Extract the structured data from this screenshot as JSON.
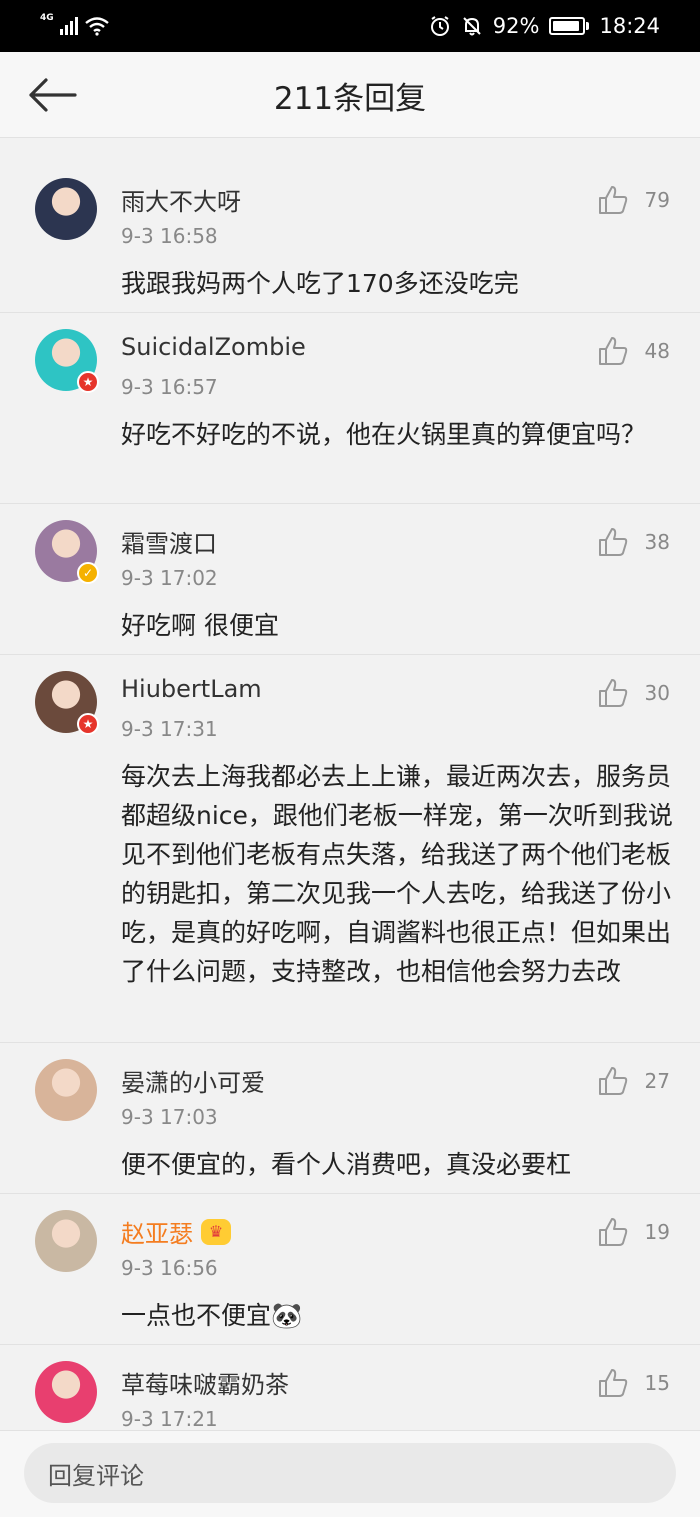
{
  "status_bar": {
    "network": "4G",
    "battery": "92%",
    "battery_level": 0.92,
    "time": "18:24"
  },
  "header": {
    "title": "211条回复"
  },
  "reply_bar": {
    "placeholder": "回复评论"
  },
  "comments": [
    {
      "username": "雨大不大呀",
      "time": "9-3 16:58",
      "likes": "79",
      "content": "我跟我妈两个人吃了170多还没吃完",
      "badge": "",
      "avatar_color": "#2c3550"
    },
    {
      "username": "SuicidalZombie",
      "time": "9-3 16:57",
      "likes": "48",
      "content": "好吃不好吃的不说，他在火锅里真的算便宜吗？",
      "badge": "red",
      "avatar_color": "#2ec4c4"
    },
    {
      "username": "霜雪渡口",
      "time": "9-3 17:02",
      "likes": "38",
      "content": "好吃啊 很便宜",
      "badge": "gold",
      "avatar_color": "#9a7aa0"
    },
    {
      "username": "HiubertLam",
      "time": "9-3 17:31",
      "likes": "30",
      "content": "每次去上海我都必去上上谦，最近两次去，服务员都超级nice，跟他们老板一样宠，第一次听到我说见不到他们老板有点失落，给我送了两个他们老板的钥匙扣，第二次见我一个人去吃，给我送了份小吃，是真的好吃啊，自调酱料也很正点！但如果出了什么问题，支持整改，也相信他会努力去改",
      "badge": "red",
      "avatar_color": "#6b4a3c"
    },
    {
      "username": "晏潇的小可爱",
      "time": "9-3 17:03",
      "likes": "27",
      "content": "便不便宜的，看个人消费吧，真没必要杠",
      "badge": "",
      "avatar_color": "#d8b49a"
    },
    {
      "username": "赵亚瑟",
      "time": "9-3 16:56",
      "likes": "19",
      "content": "一点也不便宜🐼",
      "badge": "",
      "avatar_color": "#c9b8a3",
      "vip": true
    },
    {
      "username": "草莓味啵霸奶茶",
      "time": "9-3 17:21",
      "likes": "15",
      "content": "",
      "badge": "",
      "avatar_color": "#e83f6f"
    }
  ]
}
